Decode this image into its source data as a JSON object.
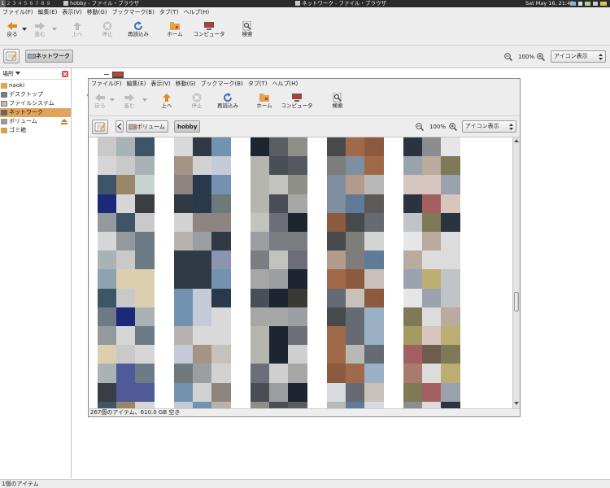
{
  "taskbar": {
    "workspaces": [
      "1",
      "2",
      "3",
      "4",
      "5",
      "6",
      "7",
      "8",
      "9"
    ],
    "tasks": [
      "hobby - ファイル・ブラウザ",
      "ネットワーク - ファイル・ブラウザ"
    ],
    "clock": "Sat May 16, 21:48"
  },
  "outer": {
    "menu": [
      "ファイル(F)",
      "編集(E)",
      "表示(V)",
      "移動(G)",
      "ブックマーク(B)",
      "タブ(T)",
      "ヘルプ(H)"
    ],
    "toolbar": {
      "back": "戻る",
      "forward": "進む",
      "up": "上へ",
      "stop": "停止",
      "reload": "再読込み",
      "home": "ホーム",
      "computer": "コンピュータ",
      "search": "検索"
    },
    "path_current": "ネットワーク",
    "zoom": "100%",
    "view": "アイコン表示",
    "sidebar_title": "場所",
    "places": [
      "naoki",
      "デスクトップ",
      "ファイルシステム",
      "ネットワーク",
      "ボリューム",
      "ゴミ箱"
    ],
    "status": "1個のアイテム",
    "partial_item": "W"
  },
  "inner": {
    "menu": [
      "ファイル(F)",
      "編集(E)",
      "表示(V)",
      "移動(G)",
      "ブックマーク(B)",
      "タブ(T)",
      "ヘルプ(H)"
    ],
    "toolbar": {
      "back": "戻る",
      "forward": "進む",
      "up": "上へ",
      "stop": "停止",
      "reload": "再読込み",
      "home": "ホーム",
      "computer": "コンピュータ",
      "search": "検索"
    },
    "path": [
      "ボリューム",
      "hobby"
    ],
    "zoom": "100%",
    "view": "アイコン表示",
    "status": "267個のアイテム、610.0 GB 空き"
  },
  "colors": {
    "selection": "#e0a55d",
    "chrome": "#ededed",
    "taskbar": "#2b2b2b"
  }
}
